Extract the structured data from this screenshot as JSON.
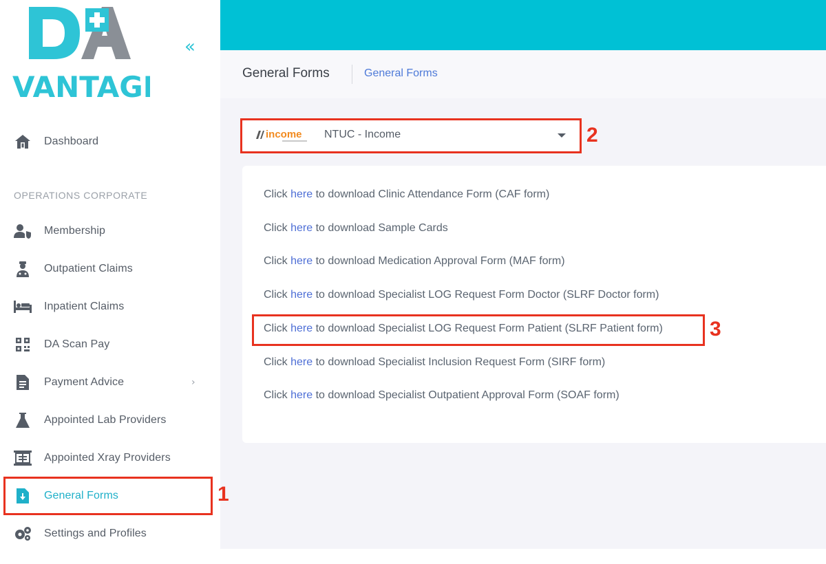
{
  "brand": {
    "logo_top": "DA",
    "logo_bottom": "VANTAGE",
    "collapse_icon": "double-chevron-left-icon"
  },
  "sidebar": {
    "dashboard": {
      "label": "Dashboard",
      "icon": "home-icon"
    },
    "section_title": "OPERATIONS CORPORATE",
    "items": [
      {
        "label": "Membership",
        "icon": "user-shield-icon"
      },
      {
        "label": "Outpatient Claims",
        "icon": "doctor-icon"
      },
      {
        "label": "Inpatient Claims",
        "icon": "bed-icon"
      },
      {
        "label": "DA Scan Pay",
        "icon": "qr-code-icon"
      },
      {
        "label": "Payment Advice",
        "icon": "document-icon",
        "has_submenu": true
      },
      {
        "label": "Appointed Lab Providers",
        "icon": "flask-icon"
      },
      {
        "label": "Appointed Xray Providers",
        "icon": "xray-icon"
      },
      {
        "label": "General Forms",
        "icon": "file-download-icon",
        "active": true
      },
      {
        "label": "Settings and Profiles",
        "icon": "gears-icon"
      }
    ]
  },
  "header": {
    "title": "General Forms",
    "breadcrumb": "General Forms"
  },
  "insurer_select": {
    "logo_text": "income",
    "value": "NTUC - Income"
  },
  "forms": {
    "prefix": "Click",
    "link_text": "here",
    "rows": [
      "to download Clinic Attendance Form (CAF form)",
      "to download Sample Cards",
      "to download Medication Approval Form (MAF form)",
      "to download Specialist LOG Request Form Doctor (SLRF Doctor form)",
      "to download Specialist LOG Request Form Patient (SLRF Patient form)",
      "to download Specialist Inclusion Request Form (SIRF form)",
      "to download Specialist Outpatient Approval Form (SOAF form)"
    ]
  },
  "annotations": [
    "1",
    "2",
    "3"
  ],
  "colors": {
    "accent": "#00c1d5",
    "link": "#4e6fd6",
    "annotation": "#e8321f",
    "logo_teal": "#2ec4d6",
    "logo_gray": "#8a8f96"
  }
}
